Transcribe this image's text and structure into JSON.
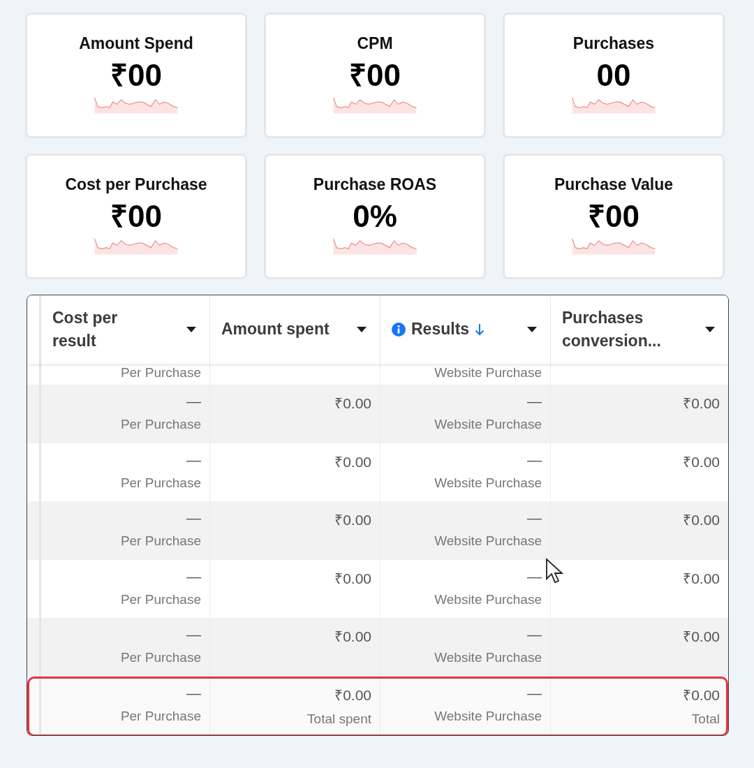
{
  "cards": [
    {
      "title": "Amount Spend",
      "value": "₹00"
    },
    {
      "title": "CPM",
      "value": "₹00"
    },
    {
      "title": "Purchases",
      "value": "00"
    },
    {
      "title": "Cost per Purchase",
      "value": "₹00"
    },
    {
      "title": "Purchase ROAS",
      "value": "0%"
    },
    {
      "title": "Purchase Value",
      "value": "₹00"
    }
  ],
  "table": {
    "columns": [
      {
        "label": "Cost per result",
        "info": false,
        "sorted": false
      },
      {
        "label": "Amount spent",
        "info": false,
        "sorted": false
      },
      {
        "label": "Results",
        "info": true,
        "sorted": true
      },
      {
        "label": "Purchases conversion...",
        "info": false,
        "sorted": false
      }
    ],
    "partial_row": {
      "cost_caption": "Per Purchase",
      "results_caption": "Website Purchase"
    },
    "rows": [
      {
        "highlighted": false,
        "cells": [
          {
            "main": "—",
            "sub": "Per Purchase"
          },
          {
            "main": "₹0.00"
          },
          {
            "main": "—",
            "sub": "Website Purchase"
          },
          {
            "main": "₹0.00"
          }
        ]
      },
      {
        "highlighted": false,
        "cells": [
          {
            "main": "—",
            "sub": "Per Purchase"
          },
          {
            "main": "₹0.00"
          },
          {
            "main": "—",
            "sub": "Website Purchase"
          },
          {
            "main": "₹0.00"
          }
        ]
      },
      {
        "highlighted": false,
        "cells": [
          {
            "main": "—",
            "sub": "Per Purchase"
          },
          {
            "main": "₹0.00"
          },
          {
            "main": "—",
            "sub": "Website Purchase"
          },
          {
            "main": "₹0.00"
          }
        ]
      },
      {
        "highlighted": false,
        "cells": [
          {
            "main": "—",
            "sub": "Per Purchase"
          },
          {
            "main": "₹0.00"
          },
          {
            "main": "—",
            "sub": "Website Purchase"
          },
          {
            "main": "₹0.00"
          }
        ]
      },
      {
        "highlighted": false,
        "cells": [
          {
            "main": "—",
            "sub": "Per Purchase"
          },
          {
            "main": "₹0.00"
          },
          {
            "main": "—",
            "sub": "Website Purchase"
          },
          {
            "main": "₹0.00"
          }
        ]
      },
      {
        "highlighted": true,
        "cells": [
          {
            "main": "—",
            "sub": "Per Purchase"
          },
          {
            "main": "₹0.00",
            "sub": "Total spent"
          },
          {
            "main": "—",
            "sub": "Website Purchase"
          },
          {
            "main": "₹0.00",
            "sub": "Total"
          }
        ]
      }
    ]
  }
}
